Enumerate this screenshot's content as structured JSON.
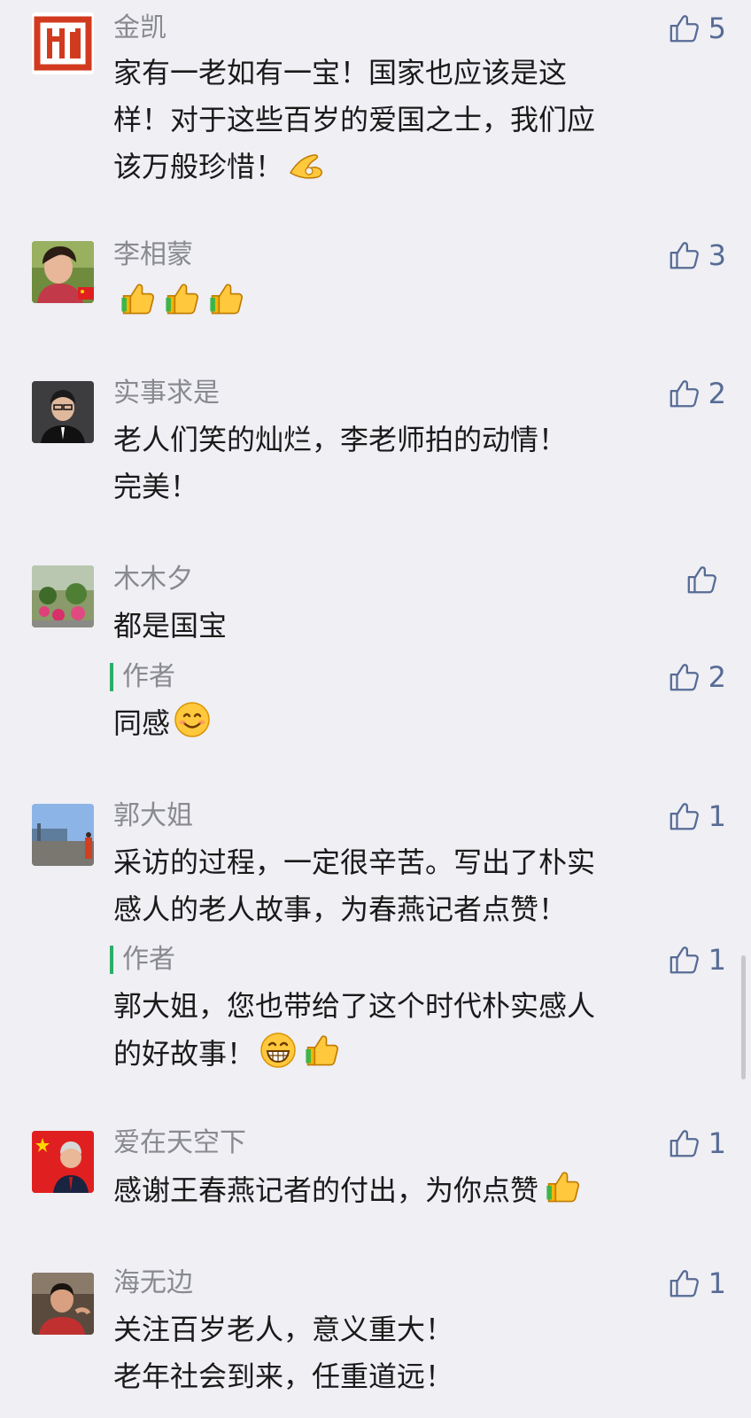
{
  "comments": [
    {
      "name": "金凯",
      "likes": "5",
      "lines": [
        "家有一老如有一宝！国家也应该是这",
        "样！对于这些百岁的爱国之士，我们应",
        "该万般珍惜！"
      ]
    },
    {
      "name": "李相蒙",
      "likes": "3",
      "lines": [
        ""
      ]
    },
    {
      "name": "实事求是",
      "likes": "2",
      "lines": [
        "老人们笑的灿烂，李老师拍的动情！",
        "完美！"
      ]
    },
    {
      "name": "木木夕",
      "likes": "",
      "lines": [
        "都是国宝"
      ],
      "reply": {
        "author_label": "作者",
        "likes": "2",
        "lines": [
          "同感"
        ]
      }
    },
    {
      "name": "郭大姐",
      "likes": "1",
      "lines": [
        "采访的过程，一定很辛苦。写出了朴实",
        "感人的老人故事，为春燕记者点赞！"
      ],
      "reply": {
        "author_label": "作者",
        "likes": "1",
        "lines": [
          "郭大姐，您也带给了这个时代朴实感人",
          "的好故事！"
        ]
      }
    },
    {
      "name": "爱在天空下",
      "likes": "1",
      "lines": [
        "感谢王春燕记者的付出，为你点赞"
      ]
    },
    {
      "name": "海无边",
      "likes": "1",
      "lines": [
        "关注百岁老人，意义重大！",
        "老年社会到来，任重道远！"
      ]
    }
  ],
  "colors": {
    "background": "#efeff4",
    "name": "#888a8f",
    "like": "#576b95",
    "author_bar": "#2aae67"
  }
}
